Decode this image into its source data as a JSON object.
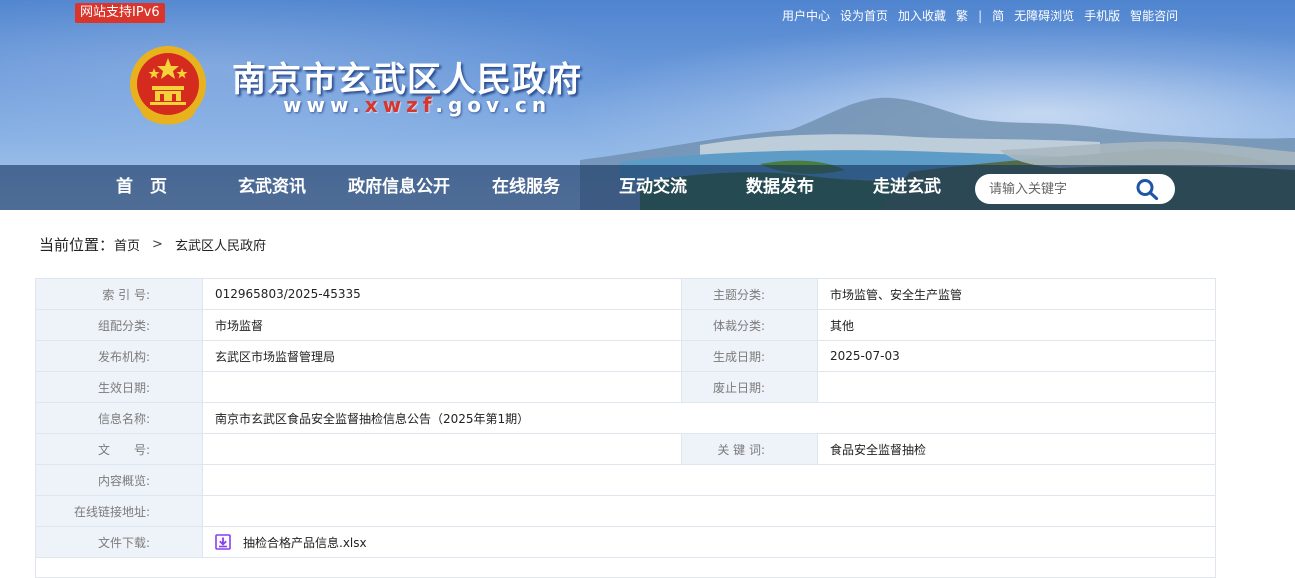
{
  "header": {
    "ipv6_badge": "网站支持IPv6",
    "site_title": "南京市玄武区人民政府",
    "site_url_prefix": "www.",
    "site_url_accent": "xwzf",
    "site_url_suffix": ".gov.cn",
    "top_links": [
      "用户中心",
      "设为首页",
      "加入收藏",
      "繁",
      "|",
      "简",
      "无障碍浏览",
      "手机版",
      "智能咨问"
    ]
  },
  "nav": {
    "items": [
      "首　页",
      "玄武资讯",
      "政府信息公开",
      "在线服务",
      "互动交流",
      "数据发布",
      "走进玄武"
    ],
    "search_placeholder": "请输入关键字"
  },
  "breadcrumb": {
    "label": "当前位置：",
    "home": "首页",
    "arrow": ">",
    "current": "玄武区人民政府"
  },
  "info": {
    "index_label": "索 引 号:",
    "index_value": "012965803/2025-45335",
    "topic_label": "主题分类:",
    "topic_value": "市场监管、安全生产监管",
    "group_label": "组配分类:",
    "group_value": "市场监督",
    "genre_label": "体裁分类:",
    "genre_value": "其他",
    "publisher_label": "发布机构:",
    "publisher_value": "玄武区市场监督管理局",
    "created_label": "生成日期:",
    "created_value": "2025-07-03",
    "effective_label": "生效日期:",
    "effective_value": "",
    "expire_label": "废止日期:",
    "expire_value": "",
    "name_label": "信息名称:",
    "name_value": "南京市玄武区食品安全监督抽检信息公告（2025年第1期）",
    "docno_label": "文　　号:",
    "docno_value": "",
    "keywords_label": "关 键 词:",
    "keywords_value": "食品安全监督抽检",
    "summary_label": "内容概览:",
    "summary_value": "",
    "link_label": "在线链接地址:",
    "link_value": "",
    "download_label": "文件下载:",
    "download_file": "抽检合格产品信息.xlsx"
  },
  "colors": {
    "nav_bg": "#163460",
    "label_bg": "#eef3f9",
    "border": "#dfe6ee",
    "ipv6_red": "#d9352b",
    "download_purple": "#8a3df0"
  }
}
